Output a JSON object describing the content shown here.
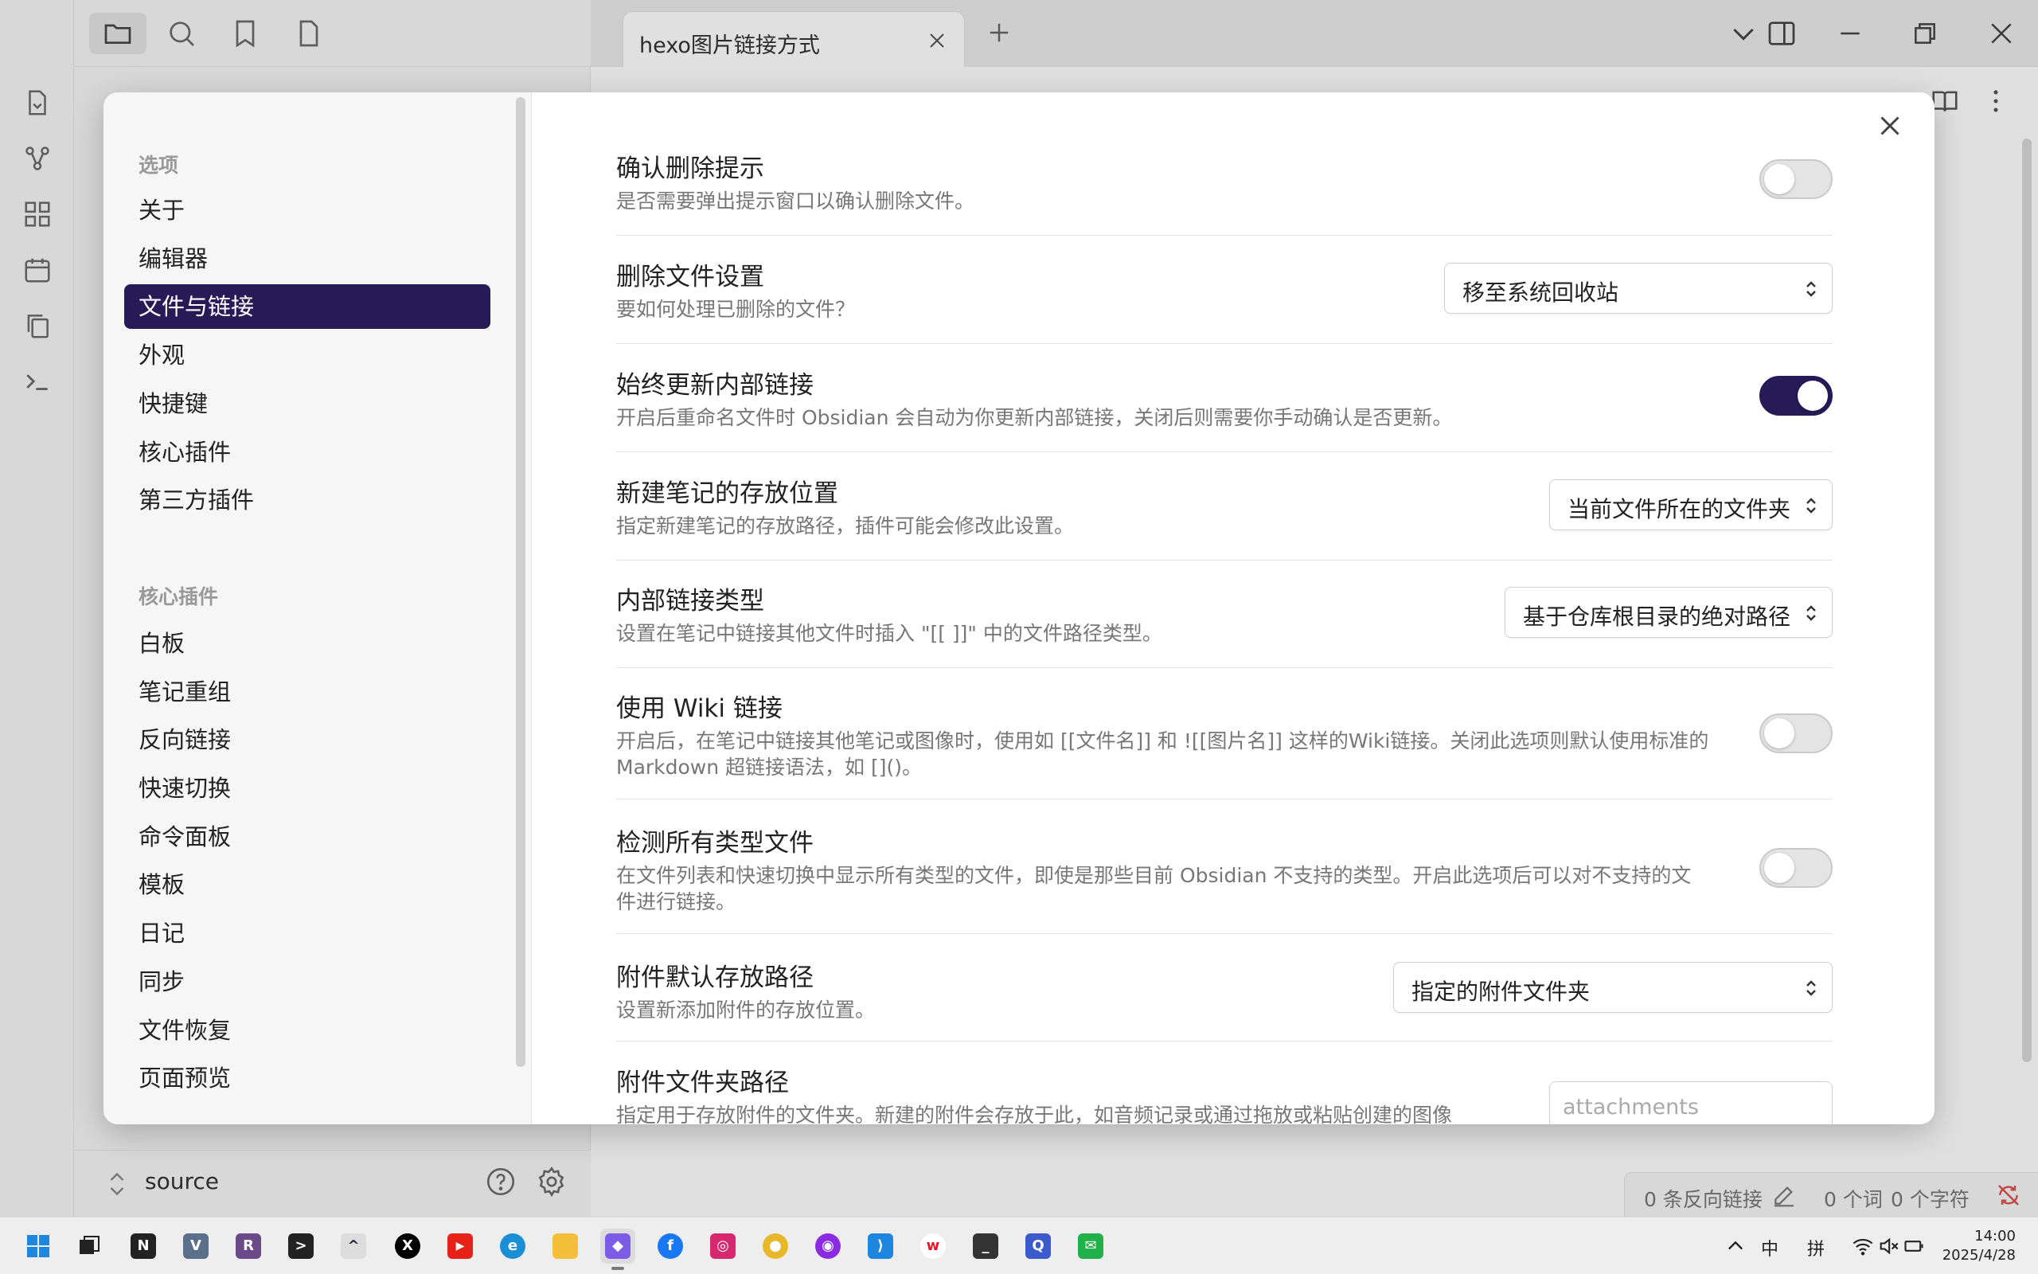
{
  "window": {
    "tab_title": "hexo图片链接方式"
  },
  "vault": {
    "name": "source"
  },
  "status_bar": {
    "backlinks": "0 条反向链接",
    "words": "0 个词",
    "chars": "0 个字符"
  },
  "settings": {
    "nav": {
      "options_heading": "选项",
      "options": [
        "关于",
        "编辑器",
        "文件与链接",
        "外观",
        "快捷键",
        "核心插件",
        "第三方插件"
      ],
      "active_item": "文件与链接",
      "core_heading": "核心插件",
      "core_plugins": [
        "白板",
        "笔记重组",
        "反向链接",
        "快速切换",
        "命令面板",
        "模板",
        "日记",
        "同步",
        "文件恢复",
        "页面预览"
      ]
    },
    "items": [
      {
        "name": "确认删除提示",
        "desc": "是否需要弹出提示窗口以确认删除文件。",
        "control": "toggle",
        "enabled": false
      },
      {
        "name": "删除文件设置",
        "desc": "要如何处理已删除的文件？",
        "control": "dropdown",
        "value": "移至系统回收站"
      },
      {
        "name": "始终更新内部链接",
        "desc": "开启后重命名文件时 Obsidian 会自动为你更新内部链接，关闭后则需要你手动确认是否更新。",
        "control": "toggle",
        "enabled": true
      },
      {
        "name": "新建笔记的存放位置",
        "desc": "指定新建笔记的存放路径，插件可能会修改此设置。",
        "control": "dropdown",
        "value": "当前文件所在的文件夹"
      },
      {
        "name": "内部链接类型",
        "desc": "设置在笔记中链接其他文件时插入 \"[[ ]]\" 中的文件路径类型。",
        "control": "dropdown",
        "value": "基于仓库根目录的绝对路径"
      },
      {
        "name": "使用 Wiki 链接",
        "desc_line1": "开启后，在笔记中链接其他笔记或图像时，使用如 [[文件名]] 和 ![[图片名]] 这样的Wiki链接。关闭此选项则默认使用标准的",
        "desc_line2": "Markdown 超链接语法，如 []()。",
        "control": "toggle",
        "enabled": false
      },
      {
        "name": "检测所有类型文件",
        "desc_line1": "在文件列表和快速切换中显示所有类型的文件，即使是那些目前 Obsidian 不支持的类型。开启此选项后可以对不支持的文",
        "desc_line2": "件进行链接。",
        "control": "toggle",
        "enabled": false
      },
      {
        "name": "附件默认存放路径",
        "desc": "设置新添加附件的存放位置。",
        "control": "dropdown",
        "value": "指定的附件文件夹"
      },
      {
        "name": "附件文件夹路径",
        "desc": "指定用于存放附件的文件夹。新建的附件会存放于此，如音频记录或通过拖放或粘贴创建的图像",
        "control": "text",
        "value": "",
        "placeholder": "attachments"
      }
    ]
  },
  "taskbar": {
    "tray_lang": "中",
    "tray_ime": "拼",
    "clock_time": "14:00",
    "clock_date": "2025/4/28"
  },
  "colors": {
    "accent": "#261a57",
    "toggle_off": "#e4e4e4",
    "desc_text": "#777777"
  }
}
